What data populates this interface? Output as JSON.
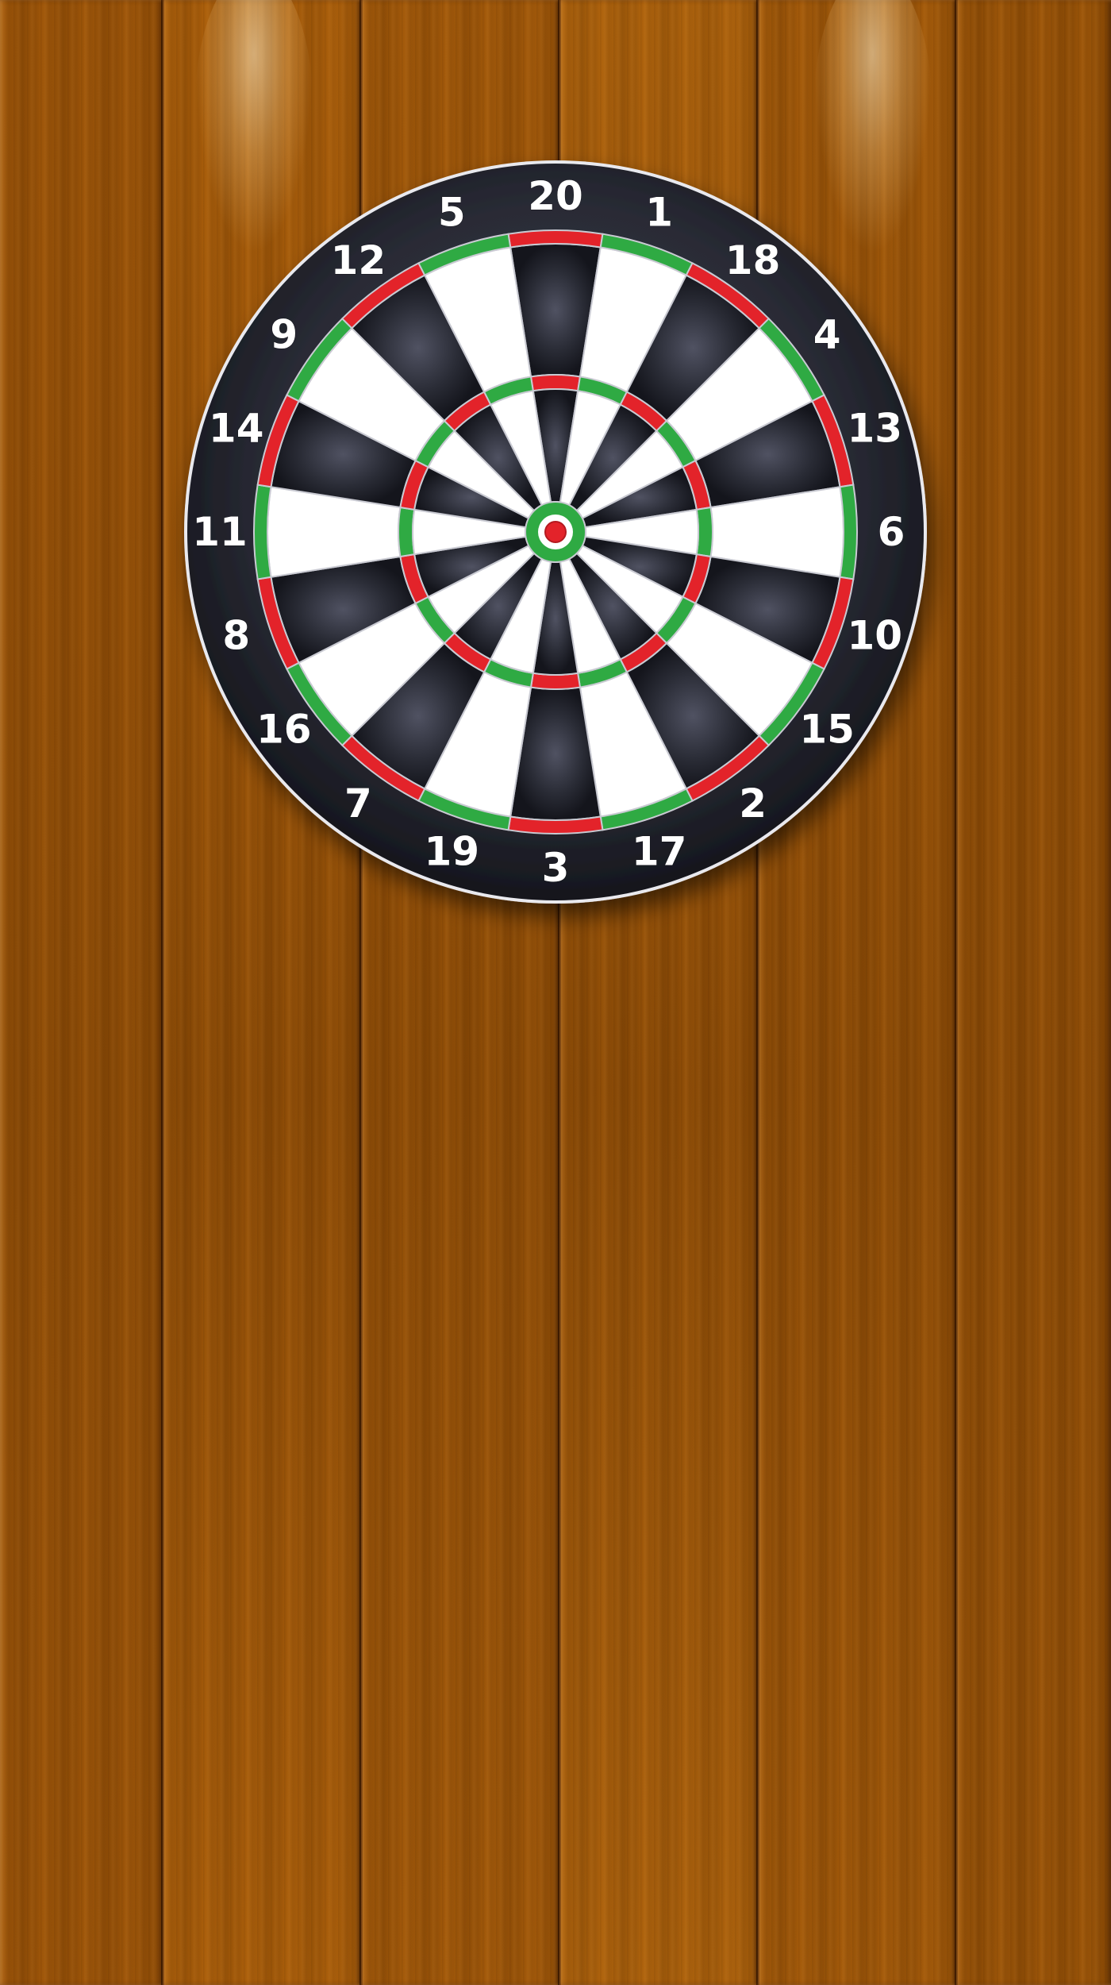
{
  "board": {
    "numbers": [
      20,
      1,
      18,
      4,
      13,
      6,
      10,
      15,
      2,
      17,
      3,
      19,
      7,
      16,
      8,
      11,
      14,
      9,
      12,
      5
    ]
  },
  "colors": {
    "wood": "#a35a08",
    "wood_dark": "#7a3f04",
    "board_surround": "#24262f",
    "segment_dark": "#1e1f28",
    "segment_light": "#ffffff",
    "ring_red": "#e3232a",
    "ring_green": "#2faa43",
    "number_text": "#ffffff"
  },
  "icons": {
    "dartboard": "dartboard-icon",
    "bullseye": "bullseye-icon"
  }
}
